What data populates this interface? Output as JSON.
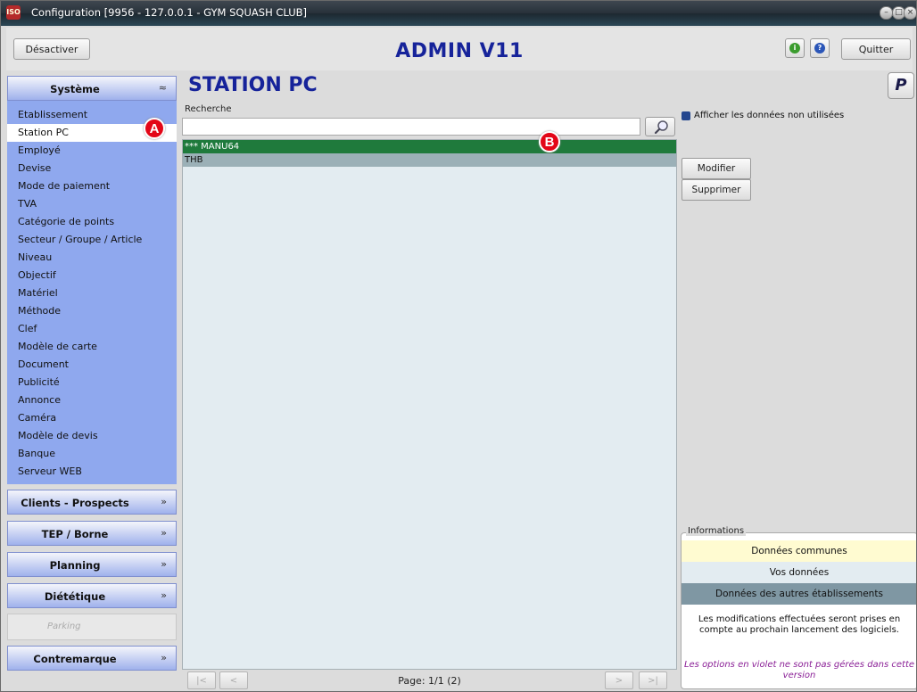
{
  "window": {
    "title": "Configuration [9956 - 127.0.0.1 - GYM SQUASH CLUB]"
  },
  "header": {
    "deactivate_label": "Désactiver",
    "app_title": "ADMIN V11",
    "quit_label": "Quitter"
  },
  "sidebar": {
    "systeme": {
      "label": "Système",
      "items": [
        "Etablissement",
        "Station PC",
        "Employé",
        "Devise",
        "Mode de paiement",
        "TVA",
        "Catégorie de points",
        "Secteur / Groupe / Article",
        "Niveau",
        "Objectif",
        "Matériel",
        "Méthode",
        "Clef",
        "Modèle de carte",
        "Document",
        "Publicité",
        "Annonce",
        "Caméra",
        "Modèle de devis",
        "Banque",
        "Serveur WEB"
      ],
      "selected": "Station PC"
    },
    "clients": "Clients - Prospects",
    "tep": "TEP / Borne",
    "planning": "Planning",
    "dietetique": "Diététique",
    "parking": "Parking",
    "contremarque": "Contremarque"
  },
  "main": {
    "title": "STATION PC",
    "search_label": "Recherche",
    "search_value": "",
    "rows": [
      "*** MANU64",
      "THB"
    ],
    "page_text": "Page: 1/1 (2)"
  },
  "right_panel": {
    "checkbox_label": "Afficher les données non utilisées",
    "modify_label": "Modifier",
    "delete_label": "Supprimer",
    "info": {
      "legend": "Informations",
      "common": "Données communes",
      "yours": "Vos données",
      "others": "Données des autres établissements",
      "text": "Les modifications effectuées seront prises en compte au prochain lancement des logiciels.",
      "note": "Les options en violet ne sont pas gérées dans cette version"
    }
  },
  "markers": {
    "a": "A",
    "b": "B"
  },
  "colors": {
    "accent_blue": "#16239a",
    "menu_blue": "#8fa8ee",
    "row_selected": "#1f7a3c",
    "row_normal": "#9bb0b7",
    "info_common": "#fffbd1",
    "info_yours": "#e3ecf1",
    "info_others": "#7f97a3",
    "marker_red": "#e30617"
  },
  "icons": {
    "app": "app-logo-icon",
    "info": "info-icon",
    "help": "help-icon",
    "search": "magnifier-icon",
    "p_logo": "p-logo-icon",
    "collapse": "double-chevron-up-icon",
    "expand": "double-chevron-down-icon"
  }
}
